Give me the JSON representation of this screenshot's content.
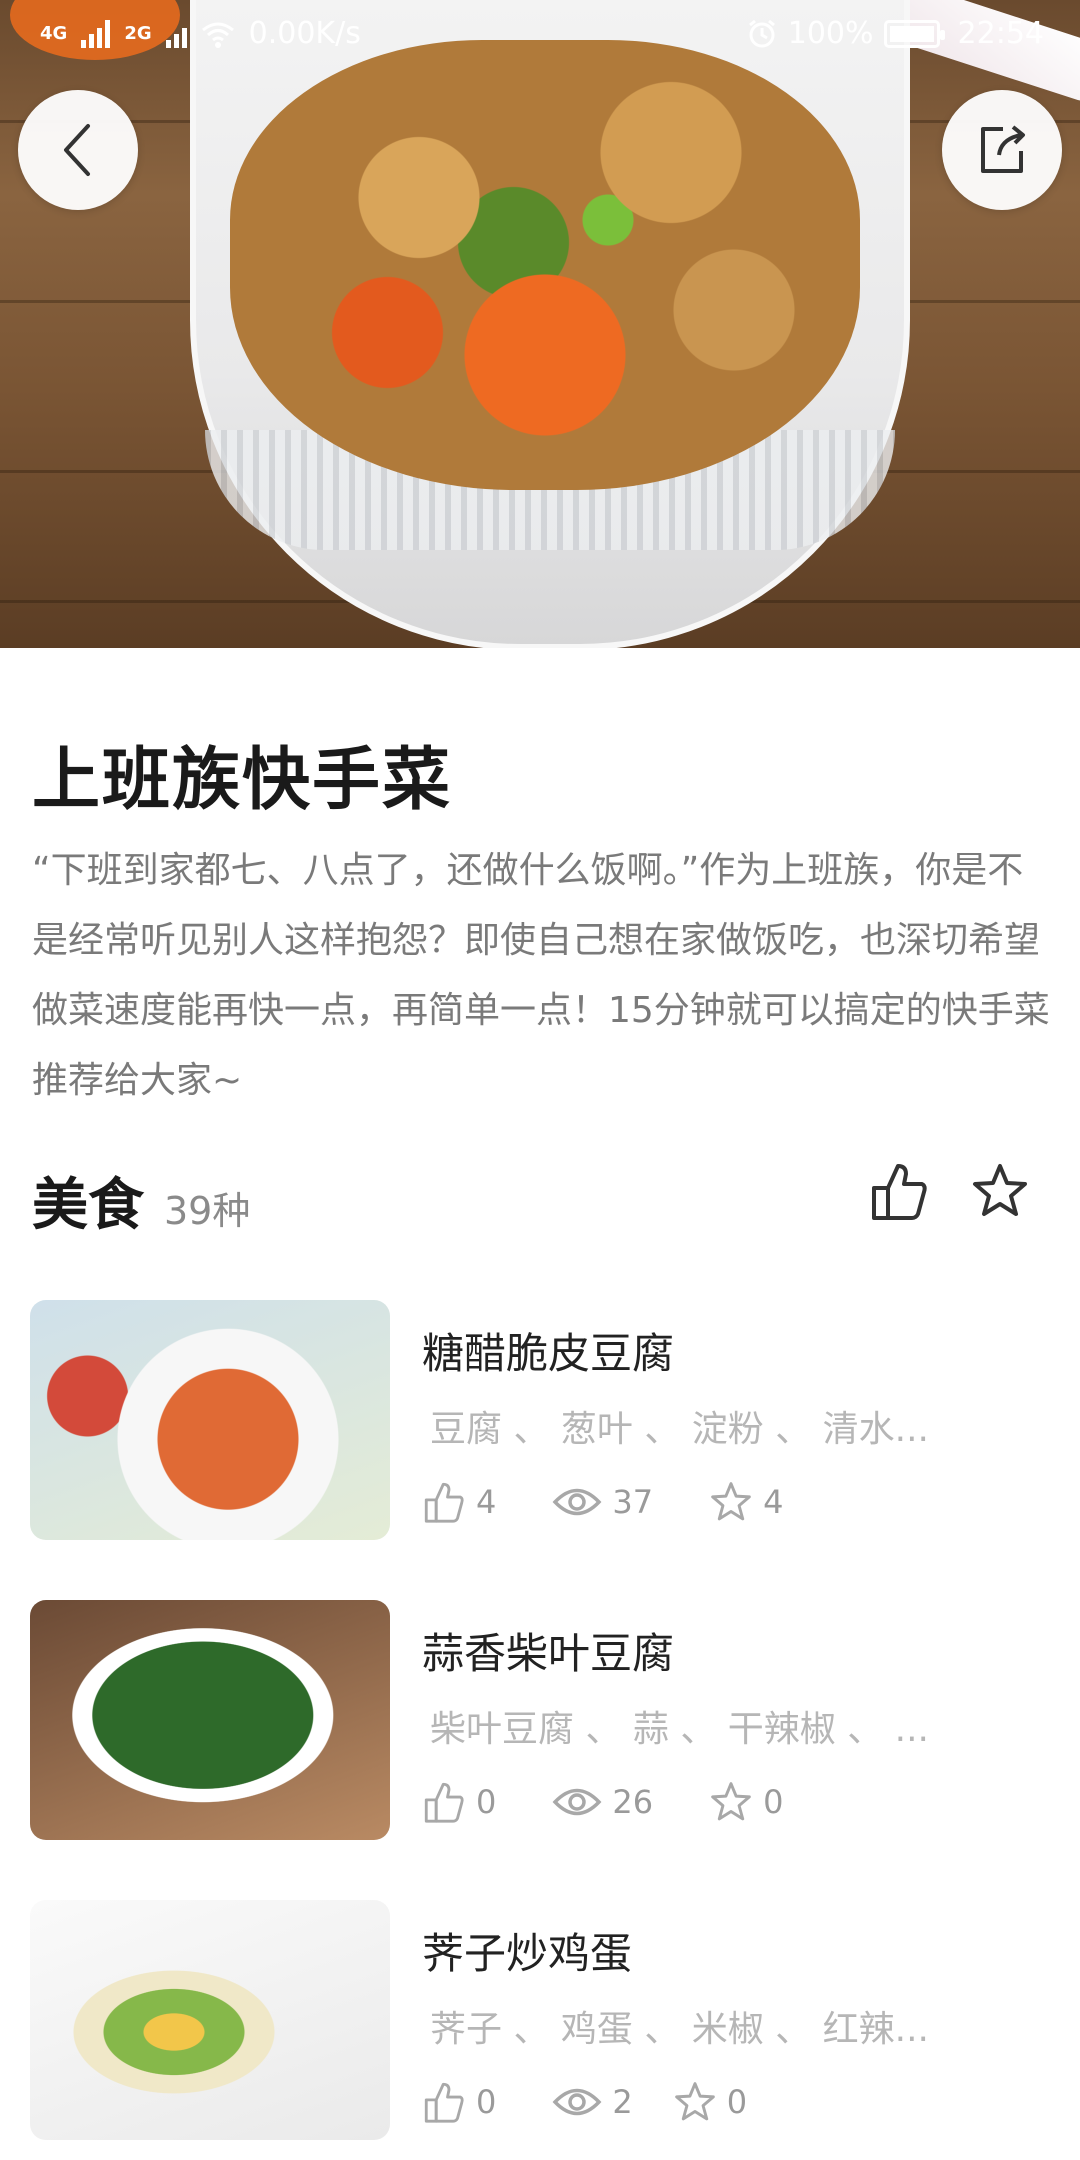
{
  "status_bar": {
    "network_1": "4G",
    "network_2": "2G",
    "speed": "0.00K/s",
    "battery": "100%",
    "time": "22:54"
  },
  "recipe": {
    "title": "上班族快手菜",
    "description": "“下班到家都七、八点了，还做什么饭啊。”作为上班族，你是不是经常听见别人这样抱怨？即使自己想在家做饭吃，也深切希望做菜速度能再快一点，再简单一点！15分钟就可以搞定的快手菜推荐给大家~"
  },
  "section": {
    "name": "美食",
    "count": "39种"
  },
  "items": [
    {
      "title": "糖醋脆皮豆腐",
      "ingredients": "豆腐 、 葱叶 、 淀粉 、 清水...",
      "likes": "4",
      "views": "37",
      "stars": "4"
    },
    {
      "title": "蒜香柴叶豆腐",
      "ingredients": "柴叶豆腐 、 蒜 、 干辣椒 、 ...",
      "likes": "0",
      "views": "26",
      "stars": "0"
    },
    {
      "title": "荠子炒鸡蛋",
      "ingredients": "荠子 、 鸡蛋 、 米椒 、 红辣...",
      "likes": "0",
      "views": "2",
      "stars": "0"
    }
  ],
  "icons": {
    "back": "chevron-left-icon",
    "share": "share-icon",
    "like": "thumbs-up-icon",
    "view": "eye-icon",
    "star": "star-icon"
  },
  "colors": {
    "title": "#1a1a1a",
    "body_text": "#7a7a7a",
    "muted": "#b6b6b6",
    "background": "#ffffff"
  }
}
